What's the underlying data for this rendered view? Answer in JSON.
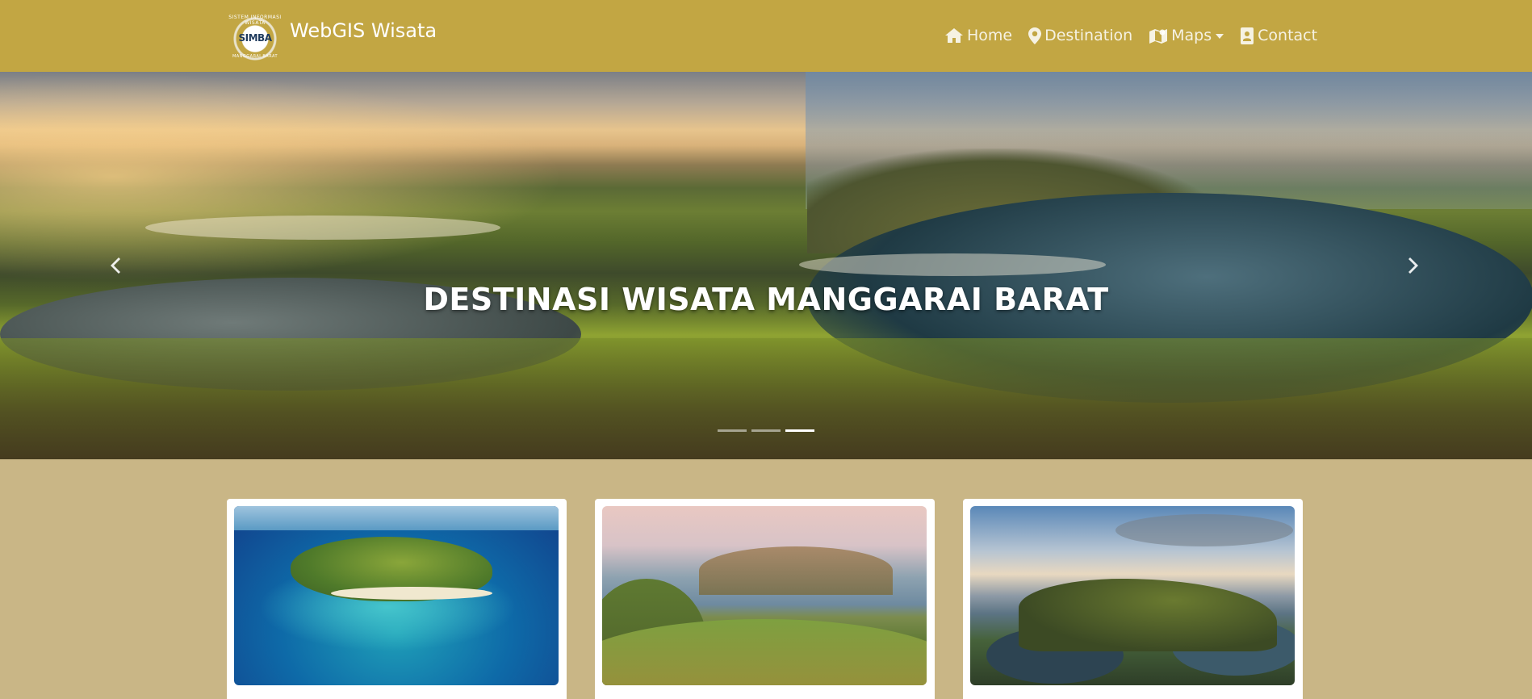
{
  "navbar": {
    "brand_title": "WebGIS Wisata",
    "logo": {
      "text": "SIMBA",
      "ring_top": "SISTEM INFORMASI WISATA",
      "ring_bottom": "MANGGARAI BARAT"
    },
    "items": [
      {
        "label": "Home",
        "icon": "home-icon"
      },
      {
        "label": "Destination",
        "icon": "map-marker-icon"
      },
      {
        "label": "Maps",
        "icon": "map-icon",
        "dropdown": true
      },
      {
        "label": "Contact",
        "icon": "address-card-icon"
      }
    ]
  },
  "hero": {
    "caption": "DESTINASI WISATA MANGGARAI BARAT",
    "slide_count": 3,
    "active_slide": 3
  },
  "colors": {
    "navbar": "#c2a643",
    "page_background": "#c9b686",
    "card_background": "#ffffff"
  }
}
